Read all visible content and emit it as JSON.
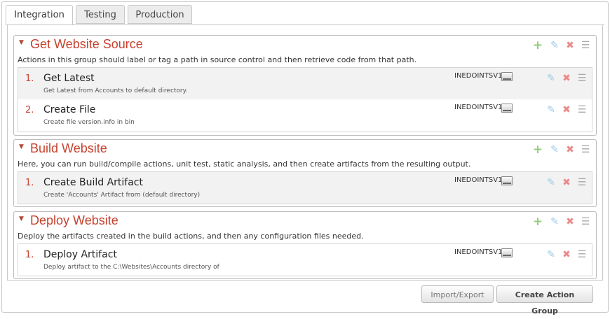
{
  "tabs": [
    {
      "label": "Integration",
      "active": true
    },
    {
      "label": "Testing",
      "active": false
    },
    {
      "label": "Production",
      "active": false
    }
  ],
  "colors": {
    "group_title": "#c8412e",
    "add_icon": "#8fce7a",
    "edit_icon": "#9ccbe8",
    "delete_icon": "#e98b8b",
    "menu_icon": "#a8a8a8"
  },
  "icons": {
    "chevron": "chevron-down-icon",
    "add": "plus-icon",
    "edit": "pencil-icon",
    "delete": "x-icon",
    "menu": "drag-handle-icon",
    "server": "drive-icon"
  },
  "groups": [
    {
      "title": "Get Website Source",
      "description": "Actions in this group should label or tag a path in source control and then retrieve code from that path.",
      "actions": [
        {
          "number": "1.",
          "title": "Get Latest",
          "description": "Get Latest from Accounts to default directory.",
          "server": "INEDOINTSV1"
        },
        {
          "number": "2.",
          "title": "Create File",
          "description": "Create file version.info in bin",
          "server": "INEDOINTSV1"
        }
      ]
    },
    {
      "title": "Build Website",
      "description": "Here, you can run build/compile actions, unit test, static analysis, and then create artifacts from the resulting output.",
      "actions": [
        {
          "number": "1.",
          "title": "Create Build Artifact",
          "description": "Create 'Accounts' Artifact from (default directory)",
          "server": "INEDOINTSV1"
        }
      ]
    },
    {
      "title": "Deploy Website",
      "description": "Deploy the artifacts created in the build actions, and then any configuration files needed.",
      "actions": [
        {
          "number": "1.",
          "title": "Deploy Artifact",
          "description": "Deploy artifact to the C:\\Websites\\Accounts directory of",
          "server": "INEDOINTSV1"
        }
      ]
    }
  ],
  "footer": {
    "import_export_label": "Import/Export",
    "create_group_label": "Create Action Group"
  }
}
